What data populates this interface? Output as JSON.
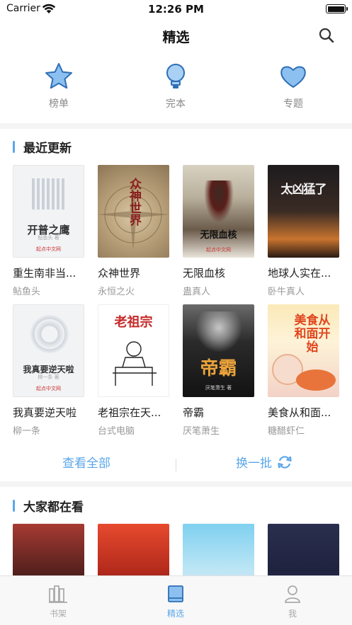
{
  "status_bar": {
    "carrier": "Carrier",
    "time": "12:26 PM"
  },
  "nav": {
    "title": "精选"
  },
  "categories": [
    {
      "label": "榜单",
      "icon": "star-icon"
    },
    {
      "label": "完本",
      "icon": "lightbulb-icon"
    },
    {
      "label": "专题",
      "icon": "heart-icon"
    }
  ],
  "recent": {
    "title": "最近更新",
    "books": [
      {
        "name": "重生南非当...",
        "author": "鲇鱼头",
        "cover_text": "开普之鹰",
        "cover_sub": "鲇鱼头 著",
        "publisher": "起点中文网"
      },
      {
        "name": "众神世界",
        "author": "永恒之火",
        "cover_text": "众神世界"
      },
      {
        "name": "无限血核",
        "author": "蛊真人",
        "cover_text": "无限血核",
        "publisher": "起点中文网"
      },
      {
        "name": "地球人实在...",
        "author": "卧牛真人",
        "cover_text": "太凶猛了"
      },
      {
        "name": "我真要逆天啦",
        "author": "柳一条",
        "cover_text": "我真要逆天啦",
        "cover_sub": "柳一条 著",
        "publisher": "起点中文网"
      },
      {
        "name": "老祖宗在天...",
        "author": "台式电脑",
        "cover_text": "老祖宗"
      },
      {
        "name": "帝霸",
        "author": "厌笔萧生",
        "cover_text": "帝霸",
        "cover_sub": "厌笔萧生 著"
      },
      {
        "name": "美食从和面...",
        "author": "糖醋虾仁",
        "cover_text": "美食从和面开始"
      }
    ],
    "view_all_label": "查看全部",
    "refresh_label": "换一批"
  },
  "popular": {
    "title": "大家都在看"
  },
  "tabbar": [
    {
      "label": "书架",
      "icon": "bookshelf-icon",
      "active": false
    },
    {
      "label": "精选",
      "icon": "book-icon",
      "active": true
    },
    {
      "label": "我",
      "icon": "profile-icon",
      "active": false
    }
  ],
  "colors": {
    "accent": "#5aa6ea",
    "icon_fill": "#a9d1f5",
    "icon_stroke": "#2e7bc7"
  }
}
